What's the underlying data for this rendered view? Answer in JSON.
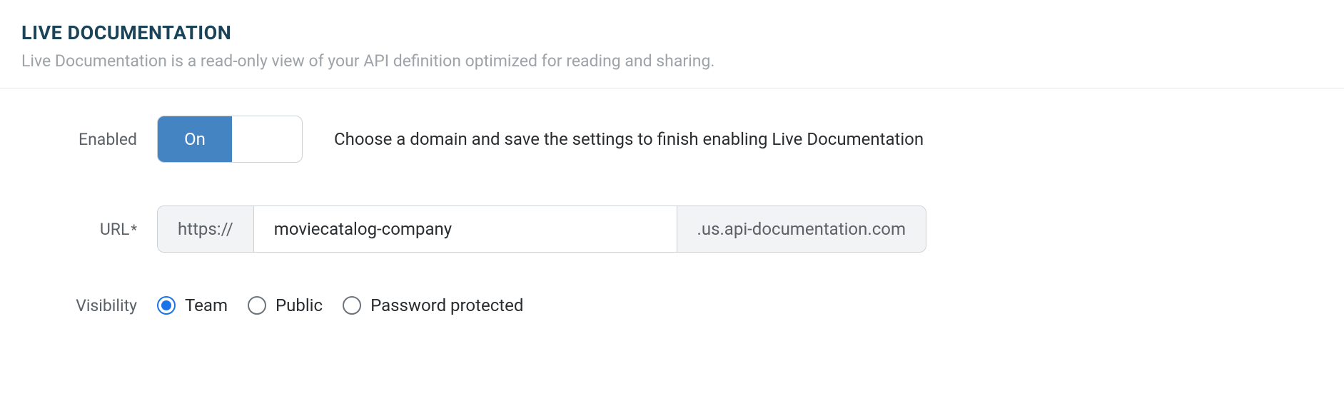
{
  "section": {
    "title": "LIVE DOCUMENTATION",
    "description": "Live Documentation is a read-only view of your API definition optimized for reading and sharing."
  },
  "enabled": {
    "label": "Enabled",
    "toggle_text": "On",
    "helper": "Choose a domain and save the settings to finish enabling Live Documentation"
  },
  "url": {
    "label": "URL",
    "required_star": "*",
    "prefix": "https://",
    "value": "moviecatalog-company",
    "suffix": ".us.api-documentation.com"
  },
  "visibility": {
    "label": "Visibility",
    "options": {
      "team": "Team",
      "public": "Public",
      "password": "Password protected"
    },
    "selected": "team"
  }
}
